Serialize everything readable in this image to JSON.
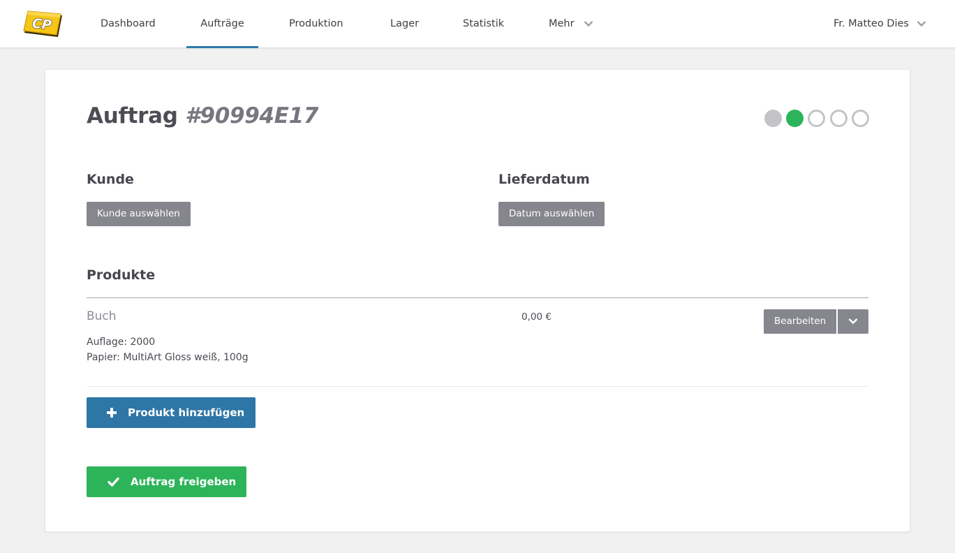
{
  "app": {
    "logo_text": "CP"
  },
  "nav": {
    "items": [
      {
        "label": "Dashboard",
        "active": false
      },
      {
        "label": "Aufträge",
        "active": true
      },
      {
        "label": "Produktion",
        "active": false
      },
      {
        "label": "Lager",
        "active": false
      },
      {
        "label": "Statistik",
        "active": false
      },
      {
        "label": "Mehr",
        "active": false,
        "dropdown": true
      }
    ],
    "user": "Fr. Matteo Dies"
  },
  "order": {
    "title_prefix": "Auftrag",
    "number": "#90994E17",
    "progress": {
      "total_steps": 5,
      "completed_steps": 1,
      "current_step": 2
    }
  },
  "customer": {
    "heading": "Kunde",
    "button_label": "Kunde auswählen"
  },
  "delivery": {
    "heading": "Lieferdatum",
    "button_label": "Datum auswählen"
  },
  "products": {
    "heading": "Produkte",
    "items": [
      {
        "name": "Buch",
        "price": "0,00 €",
        "details": [
          "Auflage: 2000",
          "Papier: MultiArt Gloss weiß, 100g"
        ],
        "edit_label": "Bearbeiten"
      }
    ],
    "add_label": "Produkt hinzufügen"
  },
  "release_label": "Auftrag freigeben",
  "colors": {
    "accent_blue": "#2e76a6",
    "success_green": "#2db45a",
    "button_gray": "#86868e",
    "logo_yellow": "#f5c518"
  }
}
